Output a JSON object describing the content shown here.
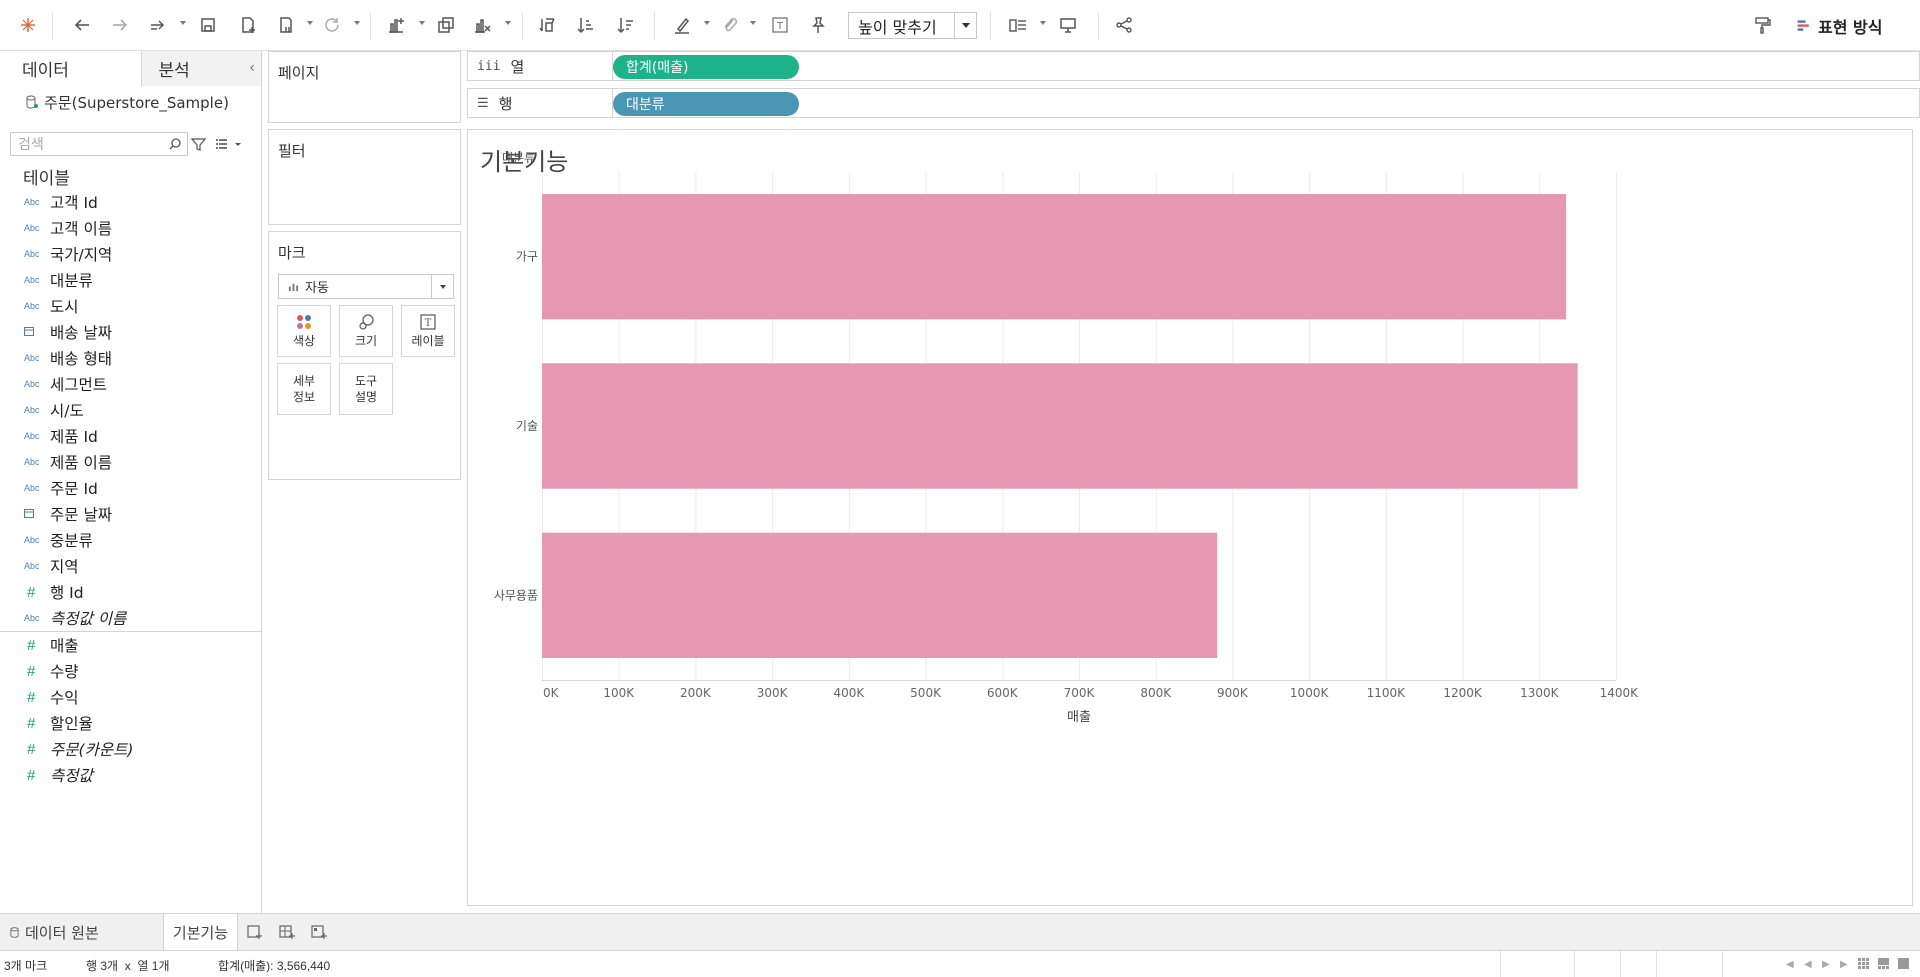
{
  "toolbar": {
    "fit_label": "높이 맞추기",
    "show_me_label": "표현 방식"
  },
  "data_pane": {
    "tab_data": "데이터",
    "tab_analysis": "분석",
    "datasource": "주문(Superstore_Sample)",
    "search_placeholder": "검색",
    "tables_header": "테이블",
    "dimensions": [
      {
        "type": "Abc",
        "name": "고객 Id"
      },
      {
        "type": "Abc",
        "name": "고객 이름"
      },
      {
        "type": "Abc",
        "name": "국가/지역"
      },
      {
        "type": "Abc",
        "name": "대분류"
      },
      {
        "type": "Abc",
        "name": "도시"
      },
      {
        "type": "date",
        "name": "배송 날짜"
      },
      {
        "type": "Abc",
        "name": "배송 형태"
      },
      {
        "type": "Abc",
        "name": "세그먼트"
      },
      {
        "type": "Abc",
        "name": "시/도"
      },
      {
        "type": "Abc",
        "name": "제품 Id"
      },
      {
        "type": "Abc",
        "name": "제품 이름"
      },
      {
        "type": "Abc",
        "name": "주문 Id"
      },
      {
        "type": "date",
        "name": "주문 날짜"
      },
      {
        "type": "Abc",
        "name": "중분류"
      },
      {
        "type": "Abc",
        "name": "지역"
      },
      {
        "type": "#",
        "name": "행 Id"
      },
      {
        "type": "Abc",
        "name": "측정값 이름",
        "italic": true
      }
    ],
    "measures": [
      {
        "type": "#",
        "name": "매출"
      },
      {
        "type": "#",
        "name": "수량"
      },
      {
        "type": "#",
        "name": "수익"
      },
      {
        "type": "#",
        "name": "할인율"
      },
      {
        "type": "#",
        "name": "주문(카운트)",
        "italic": true
      },
      {
        "type": "#",
        "name": "측정값",
        "italic": true
      }
    ]
  },
  "cards": {
    "pages": "페이지",
    "filters": "필터",
    "marks": "마크",
    "mark_type": "자동",
    "color": "색상",
    "size": "크기",
    "label": "레이블",
    "detail": "세부\n정보",
    "tooltip": "도구\n설명"
  },
  "shelves": {
    "columns_label": "열",
    "columns_icon": "iii",
    "columns_pill": "합계(매출)",
    "rows_label": "행",
    "rows_icon": "☰",
    "rows_pill": "대분류"
  },
  "colors": {
    "measure_pill": "#1eb28a",
    "dimension_pill": "#4a96b5",
    "bar": "#e698b2",
    "accent_green": "#1e9c75"
  },
  "sheet": {
    "title": "기본기능"
  },
  "chart_data": {
    "type": "bar",
    "orientation": "horizontal",
    "categories": [
      "가구",
      "기술",
      "사무용품"
    ],
    "values": [
      1335000,
      1350000,
      880000
    ],
    "row_header": "대분류",
    "xlabel": "매출",
    "xlim": [
      0,
      1400000
    ],
    "x_ticks": [
      "0K",
      "100K",
      "200K",
      "300K",
      "400K",
      "500K",
      "600K",
      "700K",
      "800K",
      "900K",
      "1000K",
      "1100K",
      "1200K",
      "1300K",
      "1400K"
    ],
    "grid": true
  },
  "tabs": {
    "data_source": "데이터 원본",
    "sheet": "기본기능"
  },
  "status": {
    "marks": "3개 마크",
    "rows_cols": "행 3개  x  열 1개",
    "sum": "합계(매출): 3,566,440"
  }
}
